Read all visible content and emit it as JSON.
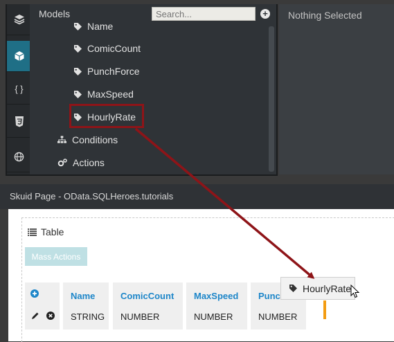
{
  "icons": {
    "sidebar": [
      "layers-icon",
      "cube-icon",
      "braces-icon",
      "css-icon",
      "globe-icon"
    ],
    "braces_glyph": "{ }"
  },
  "models": {
    "title": "Models",
    "search_placeholder": "Search...",
    "fields": [
      "Name",
      "ComicCount",
      "PunchForce",
      "MaxSpeed",
      "HourlyRate"
    ],
    "sections": [
      "Conditions",
      "Actions"
    ]
  },
  "properties": {
    "title": "Nothing Selected"
  },
  "page": {
    "title": "Skuid Page - OData.SQLHeroes.tutorials"
  },
  "table": {
    "label": "Table",
    "mass_actions": "Mass Actions",
    "columns": [
      {
        "header": "Name",
        "type": "STRING"
      },
      {
        "header": "ComicCount",
        "type": "NUMBER"
      },
      {
        "header": "MaxSpeed",
        "type": "NUMBER"
      },
      {
        "header": "Punc",
        "type": "NUMBER"
      }
    ]
  },
  "drag_item": {
    "label": "HourlyRate"
  },
  "colors": {
    "accent": "#1f6f86",
    "highlight": "#8e1418",
    "link": "#1d86c9",
    "drop_marker": "#f39c12"
  }
}
